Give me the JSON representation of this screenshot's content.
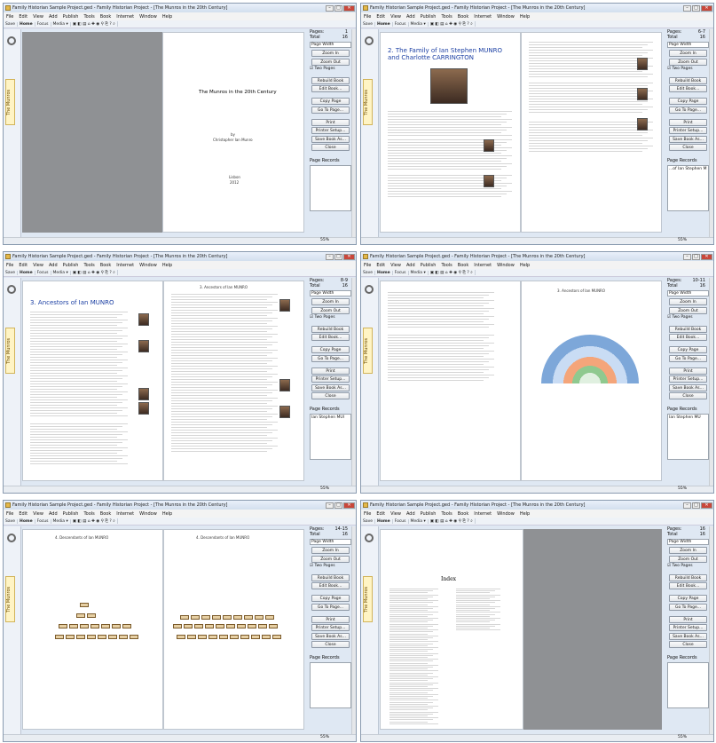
{
  "window": {
    "title": "Family Historian Sample Project.ged - Family Historian Project - [The Munros in the 20th Century]",
    "controls": [
      "–",
      "□",
      "✕"
    ]
  },
  "menu": [
    "File",
    "Edit",
    "View",
    "Add",
    "Publish",
    "Tools",
    "Book",
    "Internet",
    "Window",
    "Help"
  ],
  "toolbar": [
    "Save",
    "Home",
    "Focus",
    "Media ▾"
  ],
  "sidebar_tab": "The Munros",
  "panel": {
    "pages_label": "Pages:",
    "total_label": "Total",
    "page_width_label": "Page Width",
    "two_pages_label": "Two Pages",
    "buttons": [
      "Zoom In",
      "Zoom Out",
      "Rebuild Book",
      "Edit Book...",
      "Copy Page",
      "Go To Page...",
      "Print",
      "Printer Setup...",
      "Save Book As...",
      "Close"
    ],
    "records_label": "Page Records"
  },
  "zoom": "55%",
  "windows": [
    {
      "pages": "1",
      "total": "16",
      "records": ""
    },
    {
      "pages": "6-7",
      "total": "16",
      "records": "...of Ian Stephen M"
    },
    {
      "pages": "8-9",
      "total": "16",
      "records": "Ian Stephen MUI"
    },
    {
      "pages": "10-11",
      "total": "16",
      "records": "Ian Stephen MU"
    },
    {
      "pages": "14-15",
      "total": "16",
      "records": ""
    },
    {
      "pages": "16",
      "total": "16",
      "records": ""
    }
  ],
  "content": {
    "cover_title": "The Munros in the 20th Century",
    "cover_by": "by",
    "cover_author": "Christopher Ian Munro",
    "cover_place": "Lisbon",
    "cover_year": "2012",
    "family_heading": "2.  The Family of Ian Stephen MUNRO and Charlotte CARRINGTON",
    "ancestors_heading": "3.  Ancestors of Ian MUNRO",
    "ancestors_header": "3.  Ancestors of Ian MUNRO",
    "descendants_header": "4.  Descendants of Ian MUNRO",
    "index_heading": "Index"
  }
}
